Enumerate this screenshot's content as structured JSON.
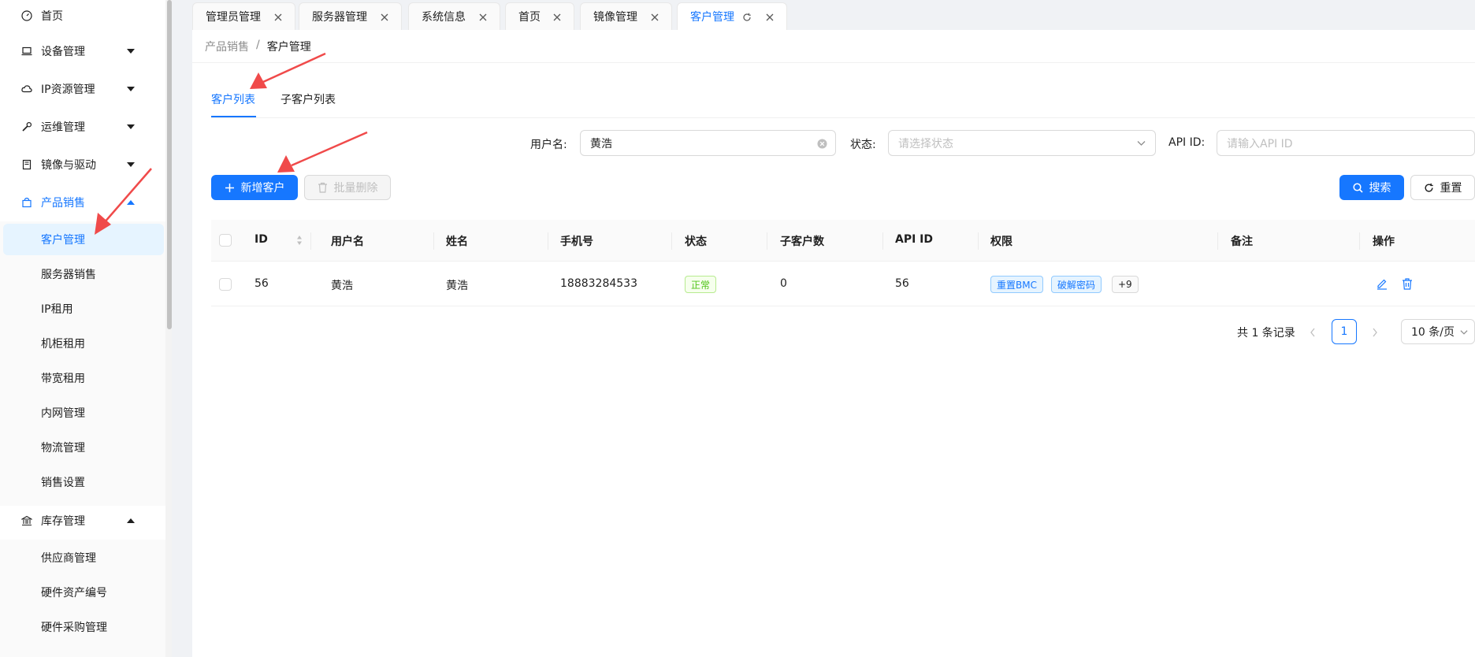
{
  "sidebar": {
    "items": [
      {
        "label": "首页",
        "icon": "dashboard-icon"
      },
      {
        "label": "设备管理",
        "icon": "laptop-icon"
      },
      {
        "label": "IP资源管理",
        "icon": "cloud-icon"
      },
      {
        "label": "运维管理",
        "icon": "tool-icon"
      },
      {
        "label": "镜像与驱动",
        "icon": "book-icon"
      },
      {
        "label": "产品销售",
        "icon": "shopping-icon"
      },
      {
        "label": "库存管理",
        "icon": "bank-icon"
      }
    ],
    "sales_sub": [
      "客户管理",
      "服务器销售",
      "IP租用",
      "机柜租用",
      "带宽租用",
      "内网管理",
      "物流管理",
      "销售设置"
    ],
    "inventory_sub": [
      "供应商管理",
      "硬件资产编号",
      "硬件采购管理"
    ]
  },
  "tabs": [
    {
      "label": "管理员管理"
    },
    {
      "label": "服务器管理"
    },
    {
      "label": "系统信息"
    },
    {
      "label": "首页"
    },
    {
      "label": "镜像管理"
    },
    {
      "label": "客户管理"
    }
  ],
  "breadcrumb": {
    "parent": "产品销售",
    "separator": "/",
    "current": "客户管理"
  },
  "subtabs": [
    "客户列表",
    "子客户列表"
  ],
  "filters": {
    "username_label": "用户名:",
    "username_value": "黄浩",
    "status_label": "状态:",
    "status_placeholder": "请选择状态",
    "apiid_label": "API ID:",
    "apiid_placeholder": "请输入API ID"
  },
  "buttons": {
    "add": "新增客户",
    "batch_delete": "批量删除",
    "search": "搜索",
    "reset": "重置"
  },
  "table": {
    "columns": [
      "ID",
      "用户名",
      "姓名",
      "手机号",
      "状态",
      "子客户数",
      "API ID",
      "权限",
      "备注",
      "操作"
    ],
    "rows": [
      {
        "id": "56",
        "username": "黄浩",
        "name": "黄浩",
        "phone": "18883284533",
        "status": "正常",
        "sub_count": "0",
        "api_id": "56",
        "perms": [
          "重置BMC",
          "破解密码",
          "+9"
        ],
        "remark": ""
      }
    ]
  },
  "pagination": {
    "total": "共 1 条记录",
    "current": "1",
    "page_size": "10 条/页"
  },
  "colors": {
    "primary": "#1677ff",
    "annotation_arrow": "#f04a4a",
    "success": "#52c41a"
  }
}
